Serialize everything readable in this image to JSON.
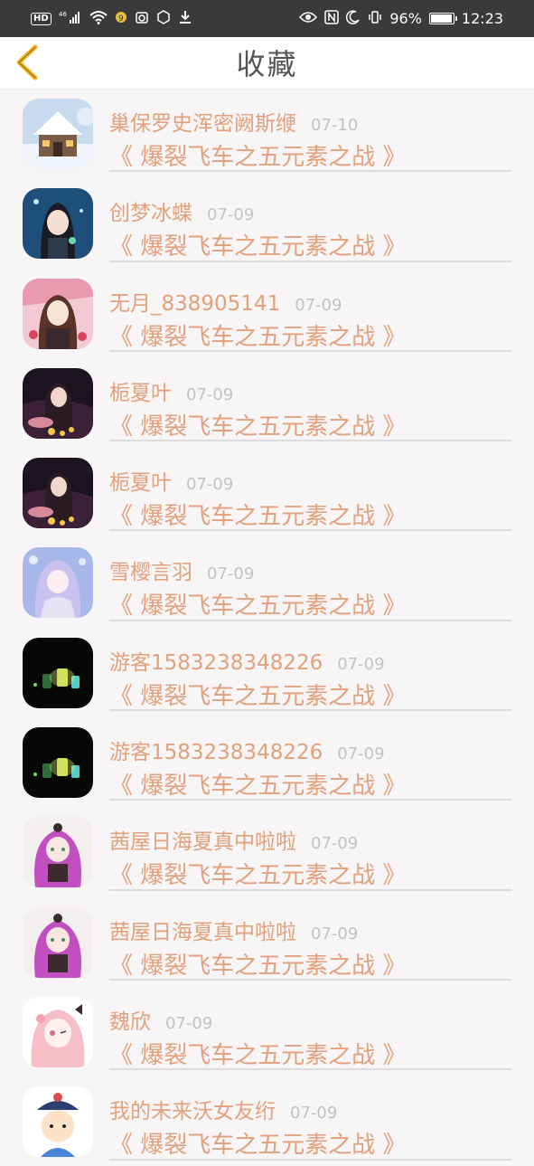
{
  "status_bar": {
    "hd": "HD",
    "network": "46",
    "battery_text": "96%",
    "battery_level": 0.96,
    "time": "12:23"
  },
  "header": {
    "title": "收藏"
  },
  "colors": {
    "accent": "#e3a07d",
    "date": "#c3c3c3",
    "back_icon": "#f2b825"
  },
  "favorites": [
    {
      "user": "巢保罗史浑密阙斯缏",
      "date": "07-10",
      "book": "《 爆裂飞车之五元素之战 》",
      "avatar": "snow-house"
    },
    {
      "user": "创梦冰蝶",
      "date": "07-09",
      "book": "《 爆裂飞车之五元素之战 》",
      "avatar": "anime-girl-blue"
    },
    {
      "user": "无月_838905141",
      "date": "07-09",
      "book": "《 爆裂飞车之五元素之战 》",
      "avatar": "anime-girl-pink"
    },
    {
      "user": "栀夏叶",
      "date": "07-09",
      "book": "《 爆裂飞车之五元素之战 》",
      "avatar": "anime-girl-dark"
    },
    {
      "user": "栀夏叶",
      "date": "07-09",
      "book": "《 爆裂飞车之五元素之战 》",
      "avatar": "anime-girl-dark"
    },
    {
      "user": "雪樱言羽",
      "date": "07-09",
      "book": "《 爆裂飞车之五元素之战 》",
      "avatar": "anime-girl-lavender"
    },
    {
      "user": "游客1583238348226",
      "date": "07-09",
      "book": "《 爆裂飞车之五元素之战 》",
      "avatar": "glowing-jars"
    },
    {
      "user": "游客1583238348226",
      "date": "07-09",
      "book": "《 爆裂飞车之五元素之战 》",
      "avatar": "glowing-jars"
    },
    {
      "user": "茜屋日海夏真中啦啦",
      "date": "07-09",
      "book": "《 爆裂飞车之五元素之战 》",
      "avatar": "anime-girl-purple"
    },
    {
      "user": "茜屋日海夏真中啦啦",
      "date": "07-09",
      "book": "《 爆裂飞车之五元素之战 》",
      "avatar": "anime-girl-purple"
    },
    {
      "user": "魏欣",
      "date": "07-09",
      "book": "《 爆裂飞车之五元素之战 》",
      "avatar": "anime-girl-pink-bow"
    },
    {
      "user": "我的未来沃女友绗",
      "date": "07-09",
      "book": "《 爆裂飞车之五元素之战 》",
      "avatar": "cartoon-boy"
    }
  ]
}
